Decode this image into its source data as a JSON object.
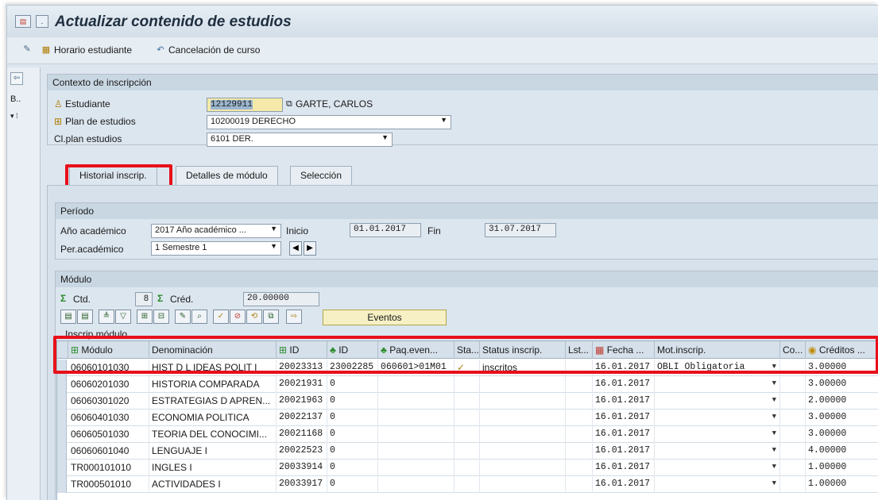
{
  "window": {
    "title": "Actualizar contenido de estudios"
  },
  "toolbar": {
    "horario_label": "Horario estudiante",
    "cancelacion_label": "Cancelación de curso"
  },
  "left_strip": {
    "label_b": "B.."
  },
  "contexto": {
    "header": "Contexto de inscripción",
    "estudiante_label": "Estudiante",
    "estudiante_value": "12129911",
    "estudiante_name": "GARTE, CARLOS",
    "plan_label": "Plan de estudios",
    "plan_value": "10200019 DERECHO",
    "clplan_label": "Cl.plan estudios",
    "clplan_value": "6101 DER."
  },
  "tabs": [
    {
      "label": "Historial inscrip."
    },
    {
      "label": "Detalles de módulo"
    },
    {
      "label": "Selección"
    }
  ],
  "periodo": {
    "header": "Período",
    "anio_label": "Año académico",
    "anio_value": "2017 Año académico ...",
    "inicio_label": "Inicio",
    "inicio_value": "01.01.2017",
    "fin_label": "Fin",
    "fin_value": "31.07.2017",
    "per_label": "Per.académico",
    "per_value": "1 Semestre 1"
  },
  "modulo": {
    "header": "Módulo",
    "ctd_label": "Ctd.",
    "ctd_value": "8",
    "cred_label": "Créd.",
    "cred_value": "20.00000",
    "eventos_label": "Eventos",
    "grid_title": "Inscrip.módulo"
  },
  "grid": {
    "columns": [
      "Módulo",
      "Denominación",
      "ID",
      "ID",
      "Paq.even...",
      "Sta...",
      "Status inscrip.",
      "Lst...",
      "Fecha ...",
      "Mot.inscrip.",
      "Co...",
      "Créditos ..."
    ],
    "rows": [
      {
        "modulo": "06060101030",
        "denom": "HIST D L IDEAS POLIT I",
        "id1": "20023313",
        "id2": "23002285",
        "paq": "060601>01M01",
        "status": "inscritos",
        "fecha": "16.01.2017",
        "mot": "OBLI Obligatoria",
        "cred": "3.00000"
      },
      {
        "modulo": "06060201030",
        "denom": "HISTORIA COMPARADA",
        "id1": "20021931",
        "id2": "0",
        "paq": "",
        "status": "",
        "fecha": "16.01.2017",
        "mot": "",
        "cred": "3.00000"
      },
      {
        "modulo": "06060301020",
        "denom": "ESTRATEGIAS D APREN...",
        "id1": "20021963",
        "id2": "0",
        "paq": "",
        "status": "",
        "fecha": "16.01.2017",
        "mot": "",
        "cred": "2.00000"
      },
      {
        "modulo": "06060401030",
        "denom": "ECONOMIA POLITICA",
        "id1": "20022137",
        "id2": "0",
        "paq": "",
        "status": "",
        "fecha": "16.01.2017",
        "mot": "",
        "cred": "3.00000"
      },
      {
        "modulo": "06060501030",
        "denom": "TEORIA DEL CONOCIMI...",
        "id1": "20021168",
        "id2": "0",
        "paq": "",
        "status": "",
        "fecha": "16.01.2017",
        "mot": "",
        "cred": "3.00000"
      },
      {
        "modulo": "06060601040",
        "denom": "LENGUAJE I",
        "id1": "20022523",
        "id2": "0",
        "paq": "",
        "status": "",
        "fecha": "16.01.2017",
        "mot": "",
        "cred": "4.00000"
      },
      {
        "modulo": "TR000101010",
        "denom": "INGLES I",
        "id1": "20033914",
        "id2": "0",
        "paq": "",
        "status": "",
        "fecha": "16.01.2017",
        "mot": "",
        "cred": "1.00000"
      },
      {
        "modulo": "TR000501010",
        "denom": "ACTIVIDADES I",
        "id1": "20033917",
        "id2": "0",
        "paq": "",
        "status": "",
        "fecha": "16.01.2017",
        "mot": "",
        "cred": "1.00000"
      }
    ]
  },
  "colors": {
    "highlight": "#e8101a",
    "panel": "#dce6ef",
    "header": "#c9d7e3"
  }
}
